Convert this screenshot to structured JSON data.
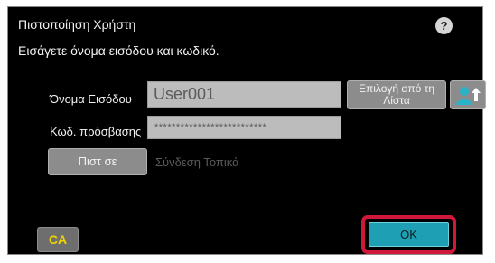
{
  "dialog": {
    "title": "Πιστοποίηση Χρήστη",
    "help_icon": "question-mark-icon",
    "help_glyph": "?",
    "instruction": "Εισάγετε όνομα εισόδου και κωδικό."
  },
  "form": {
    "username_label": "Όνομα Εισόδου",
    "username_value": "User001",
    "password_label": "Κωδ. πρόσβασης",
    "password_value": "**************************",
    "select_from_list_line1": "Επιλογή από τη",
    "select_from_list_line2": "Λίστα",
    "user_select_icon": "user-arrow-icon"
  },
  "actions": {
    "login_label": "Πιστ σε",
    "local_login_label": "Σύνδεση Τοπικά",
    "ca_label": "CA",
    "ok_label": "OK"
  },
  "colors": {
    "background": "#000000",
    "text": "#f2f2f2",
    "field": "#bcbcbc",
    "button": "#8c8c8c",
    "ok_button": "#1f9fb3",
    "highlight_frame": "#d0183a",
    "ca_text": "#f0d400"
  }
}
